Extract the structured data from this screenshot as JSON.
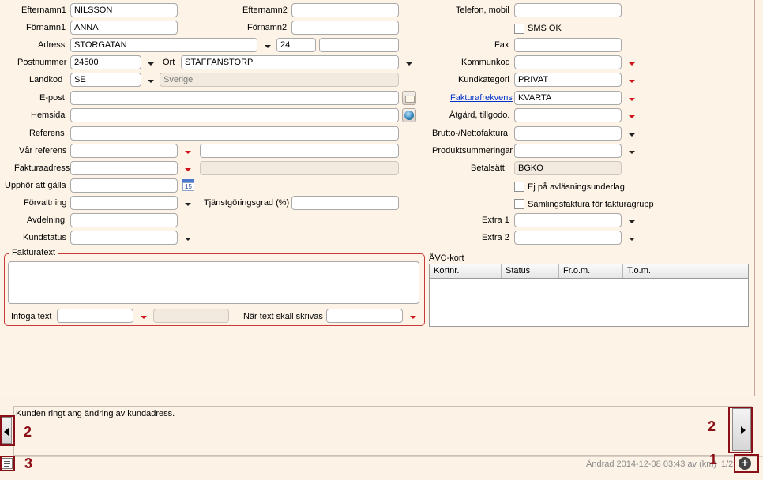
{
  "left": {
    "efternamn1": {
      "label": "Efternamn1",
      "value": "NILSSON"
    },
    "fornamn1": {
      "label": "Förnamn1",
      "value": "ANNA"
    },
    "adress": {
      "label": "Adress",
      "street": "STORGATAN",
      "number": "24",
      "extra": ""
    },
    "postnummer": {
      "label": "Postnummer",
      "value": "24500"
    },
    "ort": {
      "label": "Ort",
      "value": "STAFFANSTORP"
    },
    "landkod": {
      "label": "Landkod",
      "value": "SE",
      "country": "Sverige"
    },
    "epost": {
      "label": "E-post",
      "value": ""
    },
    "hemsida": {
      "label": "Hemsida",
      "value": ""
    },
    "referens": {
      "label": "Referens",
      "value": ""
    },
    "var_referens": {
      "label": "Vår referens",
      "value": "",
      "extra": ""
    },
    "fakturaadress": {
      "label": "Fakturaadress",
      "value": "",
      "extra": ""
    },
    "upphor": {
      "label": "Upphör att gälla",
      "value": "",
      "cal_day": "15"
    },
    "forvaltning": {
      "label": "Förvaltning",
      "value": ""
    },
    "tjanst": {
      "label": "Tjänstgöringsgrad  (%)",
      "value": ""
    },
    "avdelning": {
      "label": "Avdelning",
      "value": ""
    },
    "kundstatus": {
      "label": "Kundstatus",
      "value": ""
    }
  },
  "middle": {
    "efternamn2": {
      "label": "Efternamn2",
      "value": ""
    },
    "fornamn2": {
      "label": "Förnamn2",
      "value": ""
    }
  },
  "right": {
    "telefon": {
      "label": "Telefon, mobil",
      "value": ""
    },
    "sms": {
      "label": "SMS OK",
      "checked": false
    },
    "fax": {
      "label": "Fax",
      "value": ""
    },
    "kommunkod": {
      "label": "Kommunkod",
      "value": ""
    },
    "kundkategori": {
      "label": "Kundkategori",
      "value": "PRIVAT"
    },
    "fakturafrekvens": {
      "label": "Fakturafrekvens",
      "value": "KVARTA"
    },
    "atgard": {
      "label": "Åtgärd, tillgodo.",
      "value": ""
    },
    "brutto": {
      "label": "Brutto-/Nettofaktura",
      "value": ""
    },
    "produkt": {
      "label": "Produktsummeringar",
      "value": ""
    },
    "betalsatt": {
      "label": "Betalsätt",
      "value": "BGKO"
    },
    "ej_avlasning": {
      "label": "Ej på avläsningsunderlag",
      "checked": false
    },
    "samlingsfaktura": {
      "label": "Samlingsfaktura för fakturagrupp",
      "checked": false
    },
    "extra1": {
      "label": "Extra 1",
      "value": ""
    },
    "extra2": {
      "label": "Extra 2",
      "value": ""
    }
  },
  "fakturatext": {
    "title": "Fakturatext",
    "text": "",
    "infoga_label": "Infoga text",
    "infoga_value": "",
    "infoga_extra": "",
    "nar_label": "När text skall skrivas",
    "nar_value": ""
  },
  "avc": {
    "title": "ÅVC-kort",
    "columns": [
      "Kortnr.",
      "Status",
      "Fr.o.m.",
      "T.o.m."
    ]
  },
  "note": {
    "text": "Kunden ringt ang ändring av kundadress.",
    "status": "Ändrad 2014-12-08 03:43 av (km)",
    "pager": "1/2"
  },
  "annotations": {
    "n1": "1",
    "n2a": "2",
    "n2b": "2",
    "n3": "3",
    "color": "#8b0f16"
  },
  "colors": {
    "background": "#fdf3e6",
    "accent_red": "#d0141c",
    "link": "#0033cc"
  }
}
